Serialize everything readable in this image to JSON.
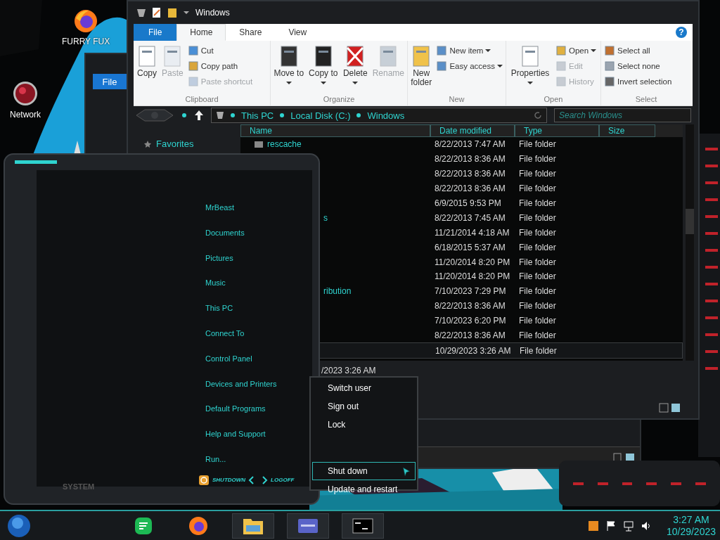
{
  "desktop_icons": [
    {
      "label": "FURRY FUX",
      "kind": "browser"
    },
    {
      "label": "Network",
      "kind": "network"
    }
  ],
  "back_window": {
    "tab": "File"
  },
  "explorer": {
    "title": "Windows",
    "ribbon_tabs": [
      {
        "label": "File",
        "kind": "file",
        "selected": false
      },
      {
        "label": "Home",
        "kind": "tab",
        "selected": true
      },
      {
        "label": "Share",
        "kind": "tab",
        "selected": false
      },
      {
        "label": "View",
        "kind": "tab",
        "selected": false
      }
    ],
    "help": "?",
    "groups": [
      {
        "name": "Clipboard",
        "items": [
          {
            "label": "Copy",
            "kind": "large",
            "disabled": false,
            "menu": false
          },
          {
            "label": "Paste",
            "kind": "large",
            "disabled": true,
            "menu": false
          },
          {
            "label": "Cut",
            "kind": "small",
            "disabled": false,
            "menu": false
          },
          {
            "label": "Copy path",
            "kind": "small",
            "disabled": false,
            "menu": false
          },
          {
            "label": "Paste shortcut",
            "kind": "small",
            "disabled": true,
            "menu": false
          }
        ]
      },
      {
        "name": "Organize",
        "items": [
          {
            "label": "Move to",
            "kind": "large",
            "disabled": false,
            "menu": true
          },
          {
            "label": "Copy to",
            "kind": "large",
            "disabled": false,
            "menu": true
          },
          {
            "label": "Delete",
            "kind": "large",
            "disabled": false,
            "menu": true
          },
          {
            "label": "Rename",
            "kind": "large",
            "disabled": true,
            "menu": false
          }
        ]
      },
      {
        "name": "New",
        "items": [
          {
            "label": "New folder",
            "kind": "large",
            "disabled": false,
            "menu": false
          },
          {
            "label": "New item",
            "kind": "small",
            "disabled": false,
            "menu": true
          },
          {
            "label": "Easy access",
            "kind": "small",
            "disabled": false,
            "menu": true
          }
        ]
      },
      {
        "name": "Open",
        "items": [
          {
            "label": "Properties",
            "kind": "large",
            "disabled": false,
            "menu": true
          },
          {
            "label": "Open",
            "kind": "small",
            "disabled": false,
            "menu": true
          },
          {
            "label": "Edit",
            "kind": "small",
            "disabled": true,
            "menu": false
          },
          {
            "label": "History",
            "kind": "small",
            "disabled": true,
            "menu": false
          }
        ]
      },
      {
        "name": "Select",
        "items": [
          {
            "label": "Select all",
            "kind": "small",
            "disabled": false,
            "menu": false
          },
          {
            "label": "Select none",
            "kind": "small",
            "disabled": false,
            "menu": false
          },
          {
            "label": "Invert selection",
            "kind": "small",
            "disabled": false,
            "menu": false
          }
        ]
      }
    ],
    "breadcrumbs": [
      "This PC",
      "Local Disk (C:)",
      "Windows"
    ],
    "search": {
      "placeholder": "Search Windows"
    },
    "nav": [
      "Favorites"
    ],
    "columns": [
      "Name",
      "Date modified",
      "Type",
      "Size"
    ],
    "rows": [
      {
        "name": "rescache",
        "date": "8/22/2013 7:47 AM",
        "type": "File folder",
        "selected": false
      },
      {
        "date": "8/22/2013 8:36 AM",
        "type": "File folder",
        "selected": false
      },
      {
        "date": "8/22/2013 8:36 AM",
        "type": "File folder",
        "selected": false
      },
      {
        "date": "8/22/2013 8:36 AM",
        "type": "File folder",
        "selected": false
      },
      {
        "date": "6/9/2015 9:53 PM",
        "type": "File folder",
        "selected": false
      },
      {
        "name": "s",
        "date": "8/22/2013 7:45 AM",
        "type": "File folder",
        "selected": false
      },
      {
        "date": "11/21/2014 4:18 AM",
        "type": "File folder",
        "selected": false
      },
      {
        "date": "6/18/2015 5:37 AM",
        "type": "File folder",
        "selected": false
      },
      {
        "date": "11/20/2014 8:20 PM",
        "type": "File folder",
        "selected": false
      },
      {
        "date": "11/20/2014 8:20 PM",
        "type": "File folder",
        "selected": false
      },
      {
        "name": "ribution",
        "date": "7/10/2023 7:29 PM",
        "type": "File folder",
        "selected": false
      },
      {
        "date": "8/22/2013 8:36 AM",
        "type": "File folder",
        "selected": false
      },
      {
        "date": "7/10/2023 6:20 PM",
        "type": "File folder",
        "selected": false
      },
      {
        "date": "8/22/2013 8:36 AM",
        "type": "File folder",
        "selected": false
      },
      {
        "date": "10/29/2023 3:26 AM",
        "type": "File folder",
        "selected": true
      }
    ],
    "details": "/2023 3:26 AM"
  },
  "start_menu": {
    "items": [
      "MrBeast",
      "Documents",
      "Pictures",
      "Music",
      "This PC",
      "Connect To",
      "Control Panel",
      "Devices and Printers",
      "Default Programs",
      "Help and Support",
      "Run..."
    ],
    "shutdown": "SHUTDOWN",
    "logoff": "LOGOFF",
    "frame_label": "SYSTEM"
  },
  "power_menu": [
    {
      "label": "Switch user",
      "selected": false
    },
    {
      "label": "Sign out",
      "selected": false
    },
    {
      "label": "Lock",
      "selected": false
    },
    {
      "label": "Shut down",
      "selected": true
    },
    {
      "label": "Update and restart",
      "selected": false
    }
  ],
  "taskbar": {
    "apps": [
      {
        "kind": "music",
        "running": false
      },
      {
        "kind": "browser",
        "running": false
      },
      {
        "kind": "folder",
        "running": true
      },
      {
        "kind": "card",
        "running": true
      },
      {
        "kind": "terminal",
        "running": true
      }
    ],
    "time": "3:27 AM",
    "date": "10/29/2023"
  }
}
